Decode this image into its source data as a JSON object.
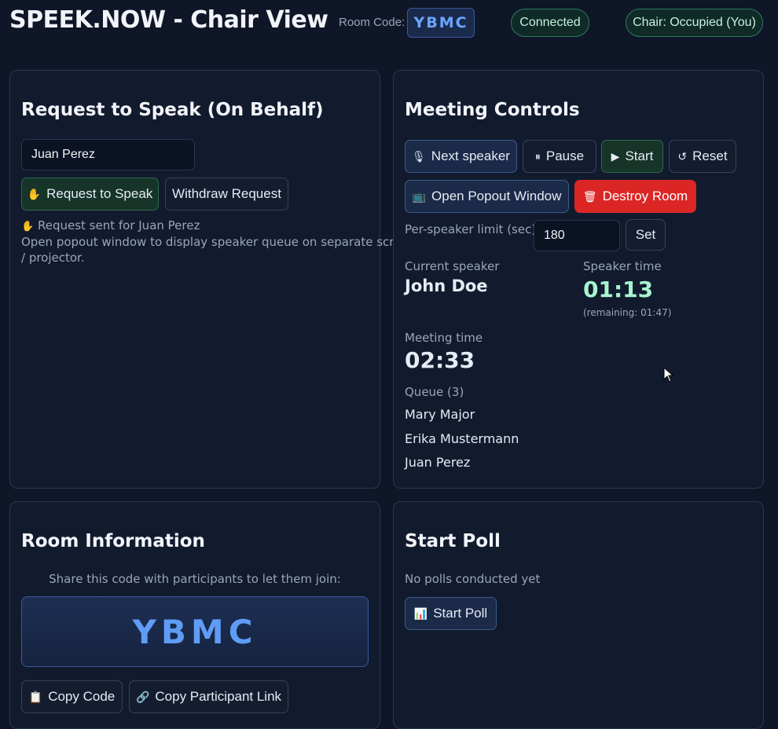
{
  "header": {
    "title": "SPEEK.NOW - Chair View",
    "room_code_label": "Room Code:",
    "room_code": "YBMC",
    "connection_status": "Connected",
    "chair_status": "Chair: Occupied (You)"
  },
  "request_panel": {
    "title": "Request to Speak (On Behalf)",
    "name_value": "Juan Perez",
    "request_button": "Request to Speak",
    "withdraw_button": "Withdraw Request",
    "status_message": "Request sent for Juan Perez",
    "help_line1": "Open popout window to display speaker queue on separate screen",
    "help_line2": "/ projector."
  },
  "meeting_controls": {
    "title": "Meeting Controls",
    "buttons": {
      "next_speaker": "Next speaker",
      "pause": "Pause",
      "start": "Start",
      "reset": "Reset",
      "open_popout": "Open Popout Window",
      "destroy_room": "Destroy Room",
      "set": "Set"
    },
    "per_speaker_label": "Per-speaker limit (sec)",
    "per_speaker_value": "180",
    "current_speaker_label": "Current speaker",
    "current_speaker": "John Doe",
    "speaker_time_label": "Speaker time",
    "speaker_time": "01:13",
    "remaining": "(remaining: 01:47)",
    "meeting_time_label": "Meeting time",
    "meeting_time": "02:33",
    "queue_label": "Queue (3)",
    "queue": [
      "Mary Major",
      "Erika Mustermann",
      "Juan Perez"
    ]
  },
  "room_info": {
    "title": "Room Information",
    "share_text": "Share this code with participants to let them join:",
    "code": "YBMC",
    "copy_code_button": "Copy Code",
    "copy_link_button": "Copy Participant Link"
  },
  "poll": {
    "title": "Start Poll",
    "status": "No polls conducted yet",
    "start_button": "Start Poll"
  },
  "colors": {
    "background": "#0f1628",
    "card": "#121b2e",
    "accent_blue": "#5e9cf6",
    "mint": "#a9f5d0",
    "danger": "#dc2626"
  }
}
